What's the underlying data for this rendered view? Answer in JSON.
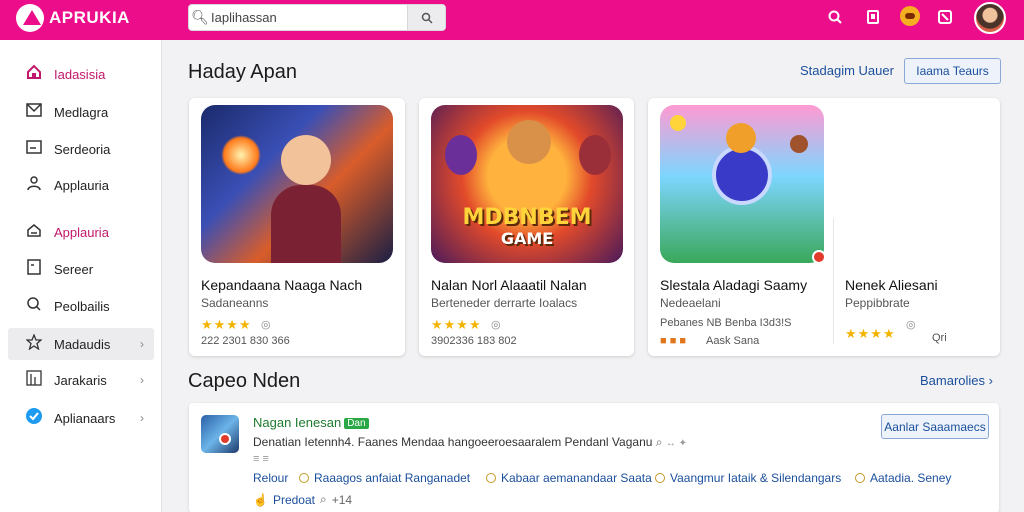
{
  "app": {
    "logo_text": "APRUKIA",
    "brand_color": "#ec0d8b"
  },
  "search": {
    "value": "Iaplihassan"
  },
  "header_icons": [
    "search-icon",
    "bookmark-icon",
    "game-controller-icon",
    "share-icon"
  ],
  "sidebar": {
    "items": [
      {
        "label": "Iadasisia",
        "icon": "home-icon"
      },
      {
        "label": "Medlagra",
        "icon": "mail-icon"
      },
      {
        "label": "Serdeoria",
        "icon": "card-icon"
      },
      {
        "label": "Applauria",
        "icon": "person-icon"
      },
      {
        "label": "Applauria",
        "icon": "stack-icon"
      },
      {
        "label": "Sereer",
        "icon": "file-icon"
      },
      {
        "label": "Peolbailis",
        "icon": "chat-icon"
      },
      {
        "label": "Madaudis",
        "icon": "star-icon"
      },
      {
        "label": "Jarakaris",
        "icon": "chart-icon"
      },
      {
        "label": "Aplianaars",
        "icon": "bird-icon"
      }
    ]
  },
  "featured": {
    "title": "Haday Apan",
    "link": "Stadagim Uauer",
    "button": "Iaama Teaurs",
    "cards": [
      {
        "title": "Kepandaana Naaga Nach",
        "subtitle": "Sadaneanns",
        "meta": "222 2301  830 366",
        "stars": "★★★★"
      },
      {
        "title": "Nalan Norl Alaaatil Nalan",
        "subtitle": "Berteneder  derrarte Ioalacs",
        "meta": "3902336  183 802",
        "stars": "★★★★",
        "art_text_1": "MDBNBEM",
        "art_text_2": "GAME"
      },
      {
        "title": "Slestala Aladagi Saamy",
        "subtitle": "Nedeaelani",
        "meta_1": "Pebanes  NB Benba I3d3!S",
        "meta_2": "Aask Sana"
      },
      {
        "title": "Nenek Aliesani",
        "subtitle": "Peppibbrate",
        "stars": "★★★★",
        "extra": "Qri"
      }
    ]
  },
  "second": {
    "title": "Capeo Nden",
    "link": "Bamarolies",
    "item": {
      "name": "Nagan Ienesan",
      "badge": "Dan",
      "description": "Denatian Ietennh4. Faanes Mendaa hangoeeroesaaralem Pendanl Vaganu",
      "tags": [
        "Relour",
        "Raaagos anfaiat Ranganadet",
        "Kabaar aemanandaar Saata",
        "Vaangmur Iataik & Silendangars",
        "Aatadia. Seney"
      ],
      "footer": "Predoat",
      "footer_meta": "+14",
      "button": "Aanlar Saaamaecs"
    }
  }
}
